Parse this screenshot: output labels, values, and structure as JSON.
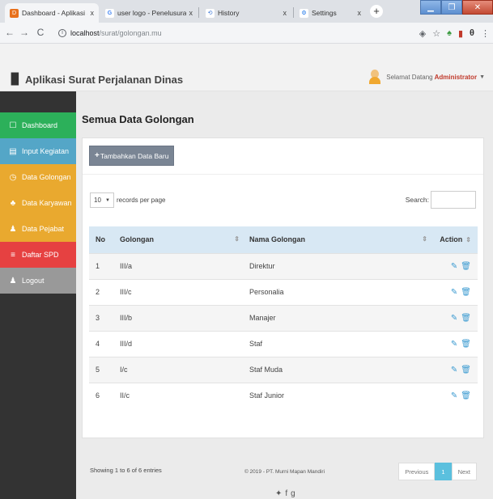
{
  "browser": {
    "tabs": [
      {
        "title": "Dashboard - Aplikasi Surat Perja",
        "close": "x",
        "icon_color": "#e8711c",
        "icon_letter": "D"
      },
      {
        "title": "user logo - Penelusuran Google",
        "close": "x",
        "icon_color": "#4285f4",
        "icon_letter": "G"
      },
      {
        "title": "History",
        "close": "x",
        "icon_color": "#3c78d8",
        "icon_letter": "⟲"
      },
      {
        "title": "Settings",
        "close": "x",
        "icon_color": "#1a73e8",
        "icon_letter": "⚙"
      }
    ],
    "new_tab": "+",
    "url_host": "localhost",
    "url_path": "/surat/golongan.mu"
  },
  "app": {
    "brand": "Aplikasi Surat Perjalanan Dinas",
    "greeting": "Selamat Datang",
    "username": "Administrator"
  },
  "sidebar": {
    "items": [
      {
        "label": "Dashboard",
        "icon": "square-icon",
        "glyph": "☐",
        "color": "#2cb05a"
      },
      {
        "label": "Input Kegiatan",
        "icon": "clipboard-icon",
        "glyph": "▤",
        "color": "#54a6c7"
      },
      {
        "label": "Data Golongan",
        "icon": "clock-icon",
        "glyph": "◷",
        "color": "#e9a92f"
      },
      {
        "label": "Data Karyawan",
        "icon": "users-icon",
        "glyph": "♣",
        "color": "#e9a92f"
      },
      {
        "label": "Data Pejabat",
        "icon": "user-icon",
        "glyph": "♟",
        "color": "#e9a92f"
      },
      {
        "label": "Daftar SPD",
        "icon": "list-icon",
        "glyph": "≡",
        "color": "#e64141"
      },
      {
        "label": "Logout",
        "icon": "user-icon",
        "glyph": "♟",
        "color": "#999999"
      }
    ]
  },
  "main": {
    "title": "Semua Data Golongan",
    "add_button": "Tambahkan Data Baru",
    "length_value": "10",
    "length_label": "records per page",
    "search_label": "Search:",
    "columns": [
      "No",
      "Golongan",
      "Nama Golongan",
      "Action"
    ],
    "rows": [
      {
        "no": "1",
        "golongan": "III/a",
        "nama": "Direktur"
      },
      {
        "no": "2",
        "golongan": "III/c",
        "nama": "Personalia"
      },
      {
        "no": "3",
        "golongan": "III/b",
        "nama": "Manajer"
      },
      {
        "no": "4",
        "golongan": "III/d",
        "nama": "Staf"
      },
      {
        "no": "5",
        "golongan": "I/c",
        "nama": "Staf Muda"
      },
      {
        "no": "6",
        "golongan": "II/c",
        "nama": "Staf Junior"
      }
    ],
    "info": "Showing 1 to 6 of 6 entries",
    "pager": {
      "previous": "Previous",
      "current": "1",
      "next": "Next"
    },
    "footer": "© 2019 - PT. Murni Mapan Mandiri"
  }
}
